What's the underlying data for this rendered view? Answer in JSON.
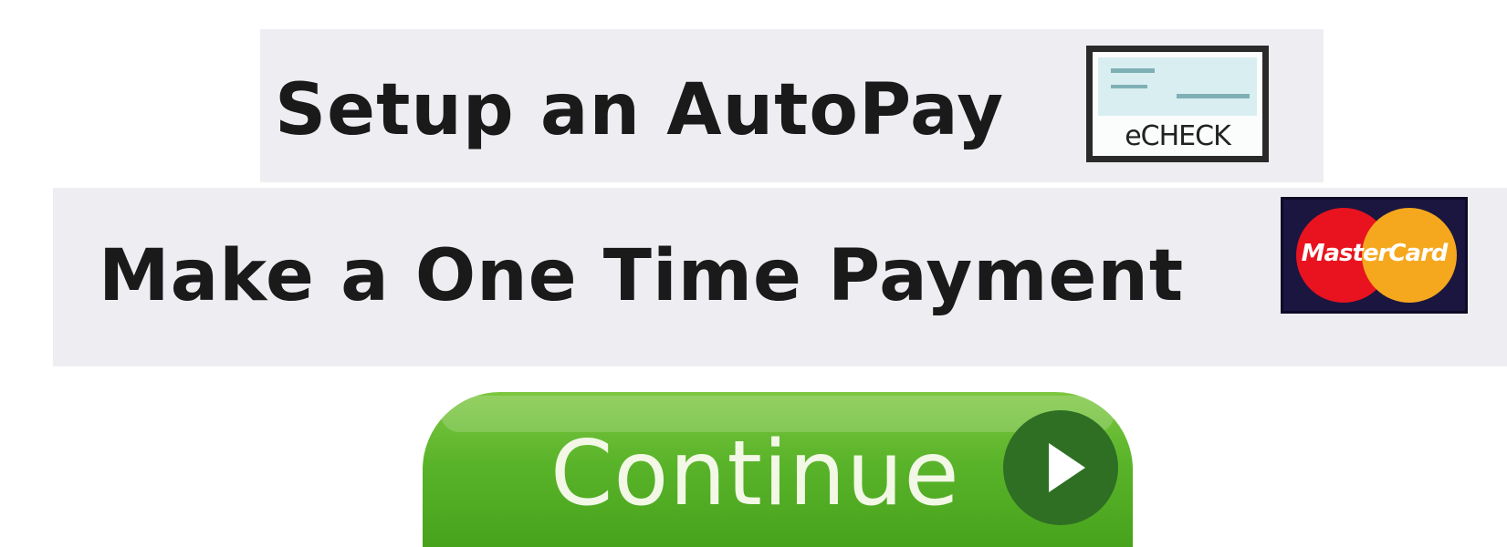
{
  "options": {
    "autopay": {
      "label": "Setup an AutoPay",
      "badge_icon": "echeck-icon",
      "badge_text": "eCHECK"
    },
    "onetime": {
      "label": "Make a One Time Payment",
      "badge_icon": "mastercard-icon",
      "badge_text": "MasterCard"
    }
  },
  "continue_button": {
    "label": "Continue",
    "icon": "play-arrow-icon"
  },
  "colors": {
    "option_background": "#eeeef2",
    "button_green": "#5ab42a",
    "play_circle_green": "#2e6f24",
    "mastercard_red": "#e8131f",
    "mastercard_yellow": "#f5a81e"
  }
}
